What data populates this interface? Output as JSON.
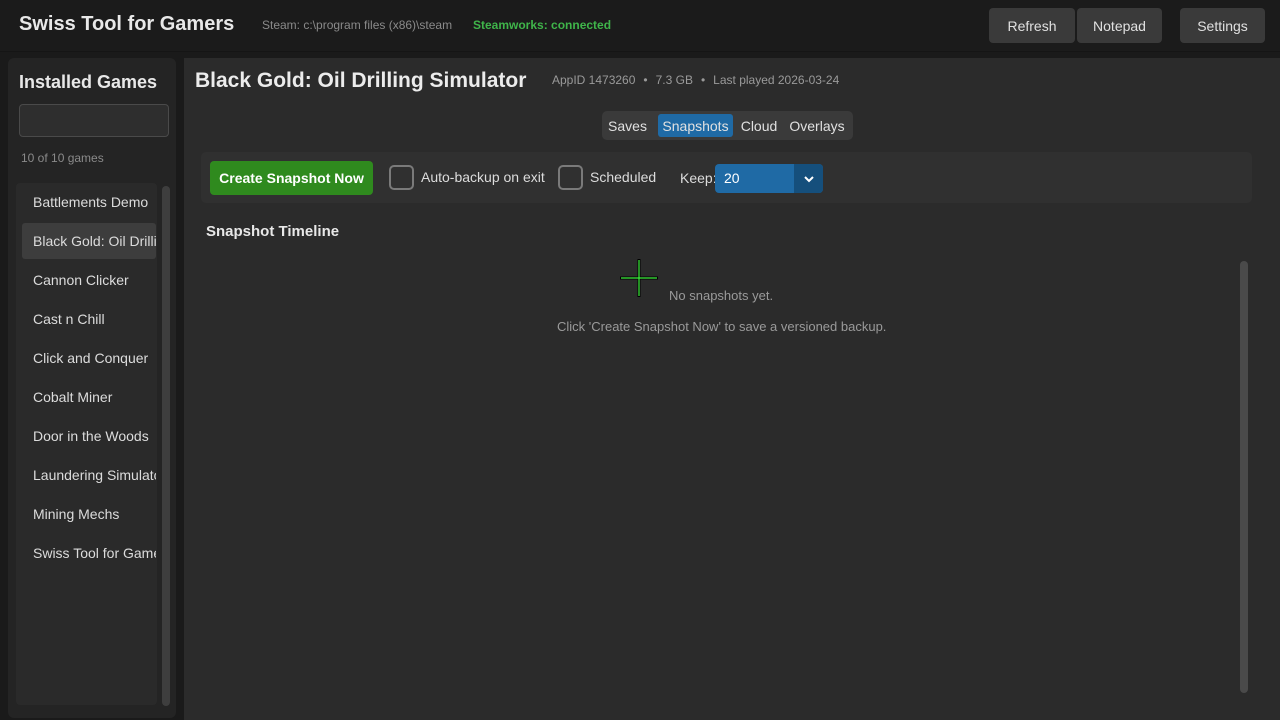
{
  "app": {
    "title": "Swiss Tool for Gamers",
    "steam_path": "Steam: c:\\program files (x86)\\steam",
    "steamworks_status": "Steamworks: connected"
  },
  "toolbar": {
    "refresh_label": "Refresh",
    "notepad_label": "Notepad",
    "settings_label": "Settings"
  },
  "sidebar": {
    "title": "Installed Games",
    "search_value": "",
    "count_text": "10 of 10 games",
    "selected_index": 1,
    "games": [
      "Battlements Demo",
      "Black Gold: Oil Drilling Simulator",
      "Cannon Clicker",
      "Cast n Chill",
      "Click and Conquer",
      "Cobalt Miner",
      "Door in the Woods",
      "Laundering Simulator",
      "Mining Mechs",
      "Swiss Tool for Gamers"
    ]
  },
  "game": {
    "title": "Black Gold: Oil Drilling Simulator",
    "appid": "AppID 1473260",
    "size": "7.3 GB",
    "last_played": "Last played 2026-03-24"
  },
  "tabs": {
    "items": [
      "Saves",
      "Snapshots",
      "Cloud",
      "Overlays"
    ],
    "active": "Snapshots"
  },
  "snapshots": {
    "create_label": "Create Snapshot Now",
    "auto_backup_label": "Auto-backup on exit",
    "auto_backup_checked": false,
    "scheduled_label": "Scheduled",
    "scheduled_checked": false,
    "keep_label": "Keep:",
    "keep_value": "20",
    "timeline_title": "Snapshot Timeline",
    "empty_title": "No snapshots yet.",
    "empty_hint": "Click 'Create Snapshot Now' to save a versioned backup."
  },
  "colors": {
    "accent": "#1f6aa5",
    "create_button": "#2f8a1e",
    "connected": "#3fb54a"
  }
}
